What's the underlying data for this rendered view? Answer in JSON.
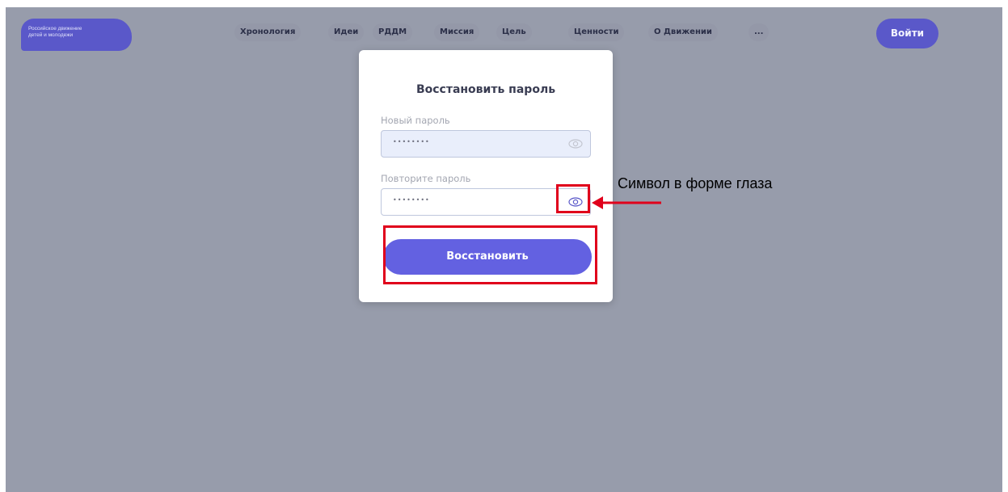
{
  "header": {
    "logo_line1": "Российское движение",
    "logo_line2": "детей и молодежи",
    "nav": [
      "Хронология",
      "Идеи",
      "РДДМ",
      "Миссия",
      "Цель",
      "Ценности",
      "О Движении",
      "..."
    ],
    "login_label": "Войти"
  },
  "modal": {
    "title": "Восстановить пароль",
    "new_password_label": "Новый пароль",
    "new_password_value": "••••••••",
    "repeat_password_label": "Повторите пароль",
    "repeat_password_value": "••••••••",
    "submit_label": "Восстановить"
  },
  "annotation": {
    "text": "Символ в форме глаза",
    "highlight_color": "#e0001b"
  },
  "colors": {
    "accent": "#5a58c9",
    "button": "#6361e1",
    "overlay": "#979cab"
  },
  "icons": {
    "password_toggle": "eye-icon"
  }
}
